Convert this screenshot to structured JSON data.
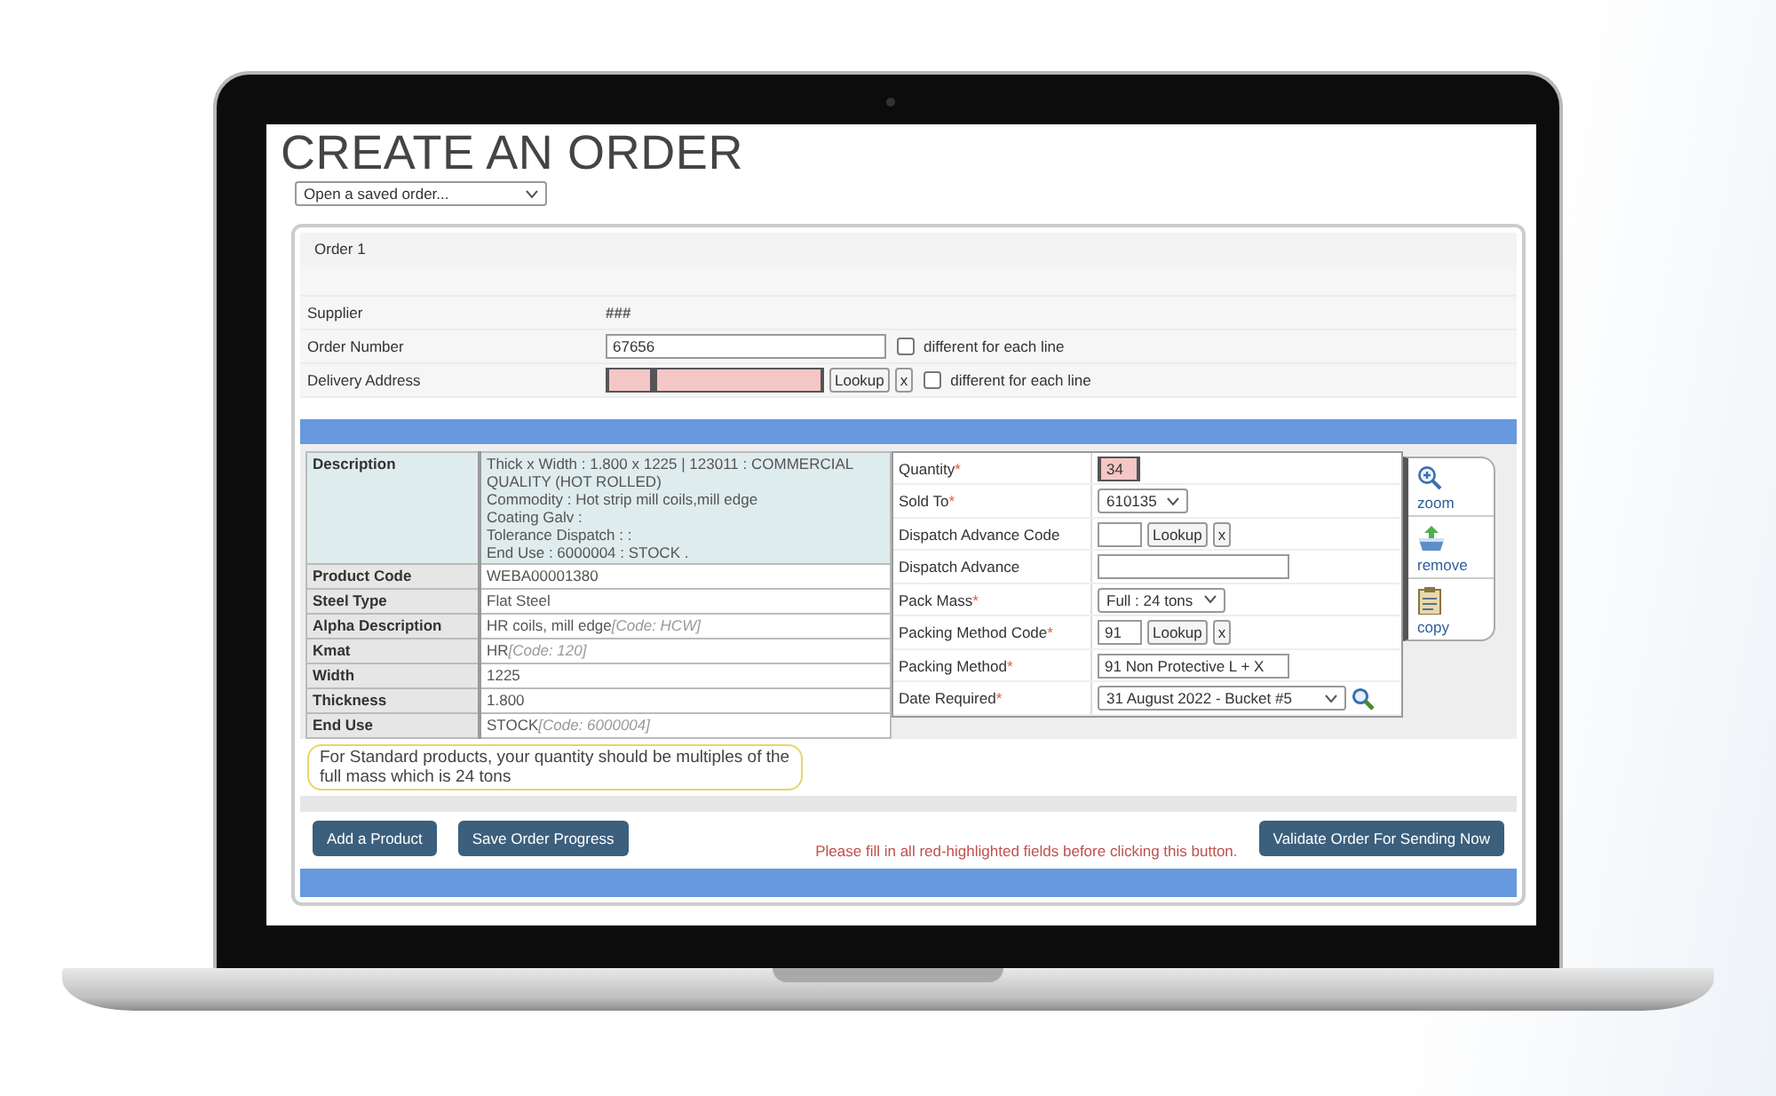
{
  "title": "CREATE AN ORDER",
  "saved_order_select": {
    "value": "Open a saved order..."
  },
  "order": {
    "heading": "Order 1",
    "fields": [
      {
        "kind": "text",
        "label": "Supplier",
        "value": "###"
      },
      {
        "kind": "input",
        "label": "Order Number",
        "value": "67656",
        "checkbox": {
          "label": "different for each line",
          "checked": false
        }
      },
      {
        "kind": "address",
        "label": "Delivery Address",
        "highlight": true,
        "button": "Lookup",
        "clear": "x",
        "checkbox": {
          "label": "different for each line",
          "checked": false
        }
      }
    ]
  },
  "product": {
    "description_label": "Description",
    "description_lines": [
      "Thick x Width : 1.800 x 1225 | 123011 : COMMERCIAL QUALITY (HOT ROLLED)",
      "Commodity : Hot strip mill coils,mill edge",
      "Coating Galv :",
      "Tolerance Dispatch : :",
      "End Use : 6000004 : STOCK ."
    ],
    "attributes": [
      {
        "label": "Product Code",
        "value": "WEBA00001380"
      },
      {
        "label": "Steel Type",
        "value": "Flat Steel"
      },
      {
        "label": "Alpha Description",
        "value": "HR coils, mill edge",
        "code": "[Code: HCW]"
      },
      {
        "label": "Kmat",
        "value": "HR",
        "code": "[Code: 120]"
      },
      {
        "label": "Width",
        "value": "1225"
      },
      {
        "label": "Thickness",
        "value": "1.800"
      },
      {
        "label": "End Use",
        "value": "STOCK",
        "code": "[Code: 6000004]"
      }
    ]
  },
  "line_fields": [
    {
      "kind": "short-input",
      "label": "Quantity",
      "required_mark": "*",
      "value": "34",
      "highlight": true
    },
    {
      "kind": "select",
      "label": "Sold To",
      "required_mark": "*",
      "value": "610135",
      "highlight": false
    },
    {
      "kind": "lookup",
      "label": "Dispatch Advance Code",
      "button": "Lookup",
      "clear": "x",
      "highlight": false
    },
    {
      "kind": "input",
      "label": "Dispatch Advance",
      "highlight": false
    },
    {
      "kind": "select",
      "label": "Pack Mass",
      "required_mark": "*",
      "value": "Full : 24 tons",
      "highlight": false
    },
    {
      "kind": "lookup",
      "label": "Packing Method Code",
      "required_mark": "*",
      "value": "91",
      "button": "Lookup",
      "clear": "x",
      "highlight": false
    },
    {
      "kind": "input",
      "label": "Packing Method",
      "required_mark": "*",
      "value": "91 Non Protective L + X",
      "highlight": false
    },
    {
      "kind": "date-select",
      "label": "Date Required",
      "required_mark": "*",
      "value": "31 August 2022 - Bucket #5",
      "highlight": false
    }
  ],
  "side_actions": [
    {
      "kind": "zoom",
      "label": "zoom"
    },
    {
      "kind": "remove",
      "label": "remove"
    },
    {
      "kind": "copy",
      "label": "copy"
    }
  ],
  "hint": "For Standard products, your quantity should be multiples of the full mass which is 24 tons",
  "buttons": [
    "Add a Product",
    "Save Order Progress"
  ],
  "warning": "Please fill in all red-highlighted fields before clicking this button.",
  "validate_button": "Validate Order For Sending Now"
}
